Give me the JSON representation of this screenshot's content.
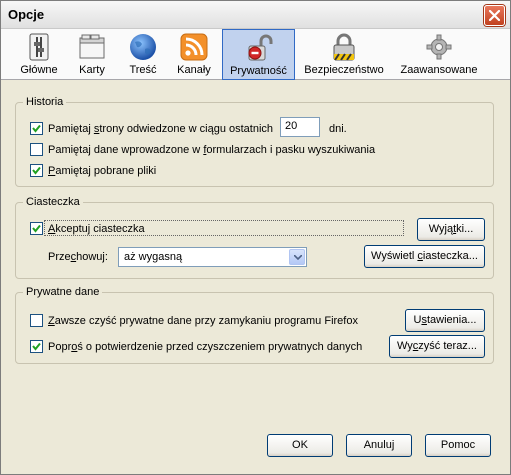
{
  "window": {
    "title": "Opcje"
  },
  "tabs": [
    {
      "label": "Główne",
      "icon": "general-switch-icon"
    },
    {
      "label": "Karty",
      "icon": "tabs-window-icon"
    },
    {
      "label": "Treść",
      "icon": "globe-icon"
    },
    {
      "label": "Kanały",
      "icon": "rss-feed-icon"
    },
    {
      "label": "Prywatność",
      "icon": "privacy-padlock-icon",
      "active": true
    },
    {
      "label": "Bezpieczeństwo",
      "icon": "security-padlock-icon"
    },
    {
      "label": "Zaawansowane",
      "icon": "gear-icon"
    }
  ],
  "historia": {
    "title": "Historia",
    "remember_pages": {
      "label_pre": "Pamiętaj ",
      "label_u": "s",
      "label_post": "trony odwiedzone w ciągu ostatnich",
      "checked": true
    },
    "days_value": "20",
    "days_unit": "dni.",
    "remember_forms": {
      "label_pre": "Pamiętaj dane wprowadzone w ",
      "label_u": "f",
      "label_post": "ormularzach i pasku wyszukiwania",
      "checked": false
    },
    "remember_downloads": {
      "label_pre": "",
      "label_u": "P",
      "label_post": "amiętaj pobrane pliki",
      "checked": true
    }
  },
  "ciasteczka": {
    "title": "Ciasteczka",
    "accept": {
      "label_pre": "",
      "label_u": "A",
      "label_post": "kceptuj ciasteczka",
      "checked": true
    },
    "exceptions_button": {
      "pre": "Wyją",
      "u": "t",
      "post": "ki..."
    },
    "keep_label": {
      "pre": "Prze",
      "u": "c",
      "post": "howuj:"
    },
    "keep_value": "aż wygasną",
    "show_button": {
      "pre": "Wyświetl ",
      "u": "c",
      "post": "iasteczka..."
    }
  },
  "prywatne": {
    "title": "Prywatne dane",
    "always_clear": {
      "label_pre": "",
      "label_u": "Z",
      "label_post": "awsze czyść prywatne dane przy zamykaniu programu Firefox",
      "checked": false
    },
    "settings_button": {
      "pre": "U",
      "u": "s",
      "post": "tawienia..."
    },
    "ask_before": {
      "label_pre": "Popr",
      "label_u": "o",
      "label_post": "ś o potwierdzenie przed czyszczeniem prywatnych danych",
      "checked": true
    },
    "clear_now_button": {
      "pre": "Wy",
      "u": "c",
      "post": "zyść teraz..."
    }
  },
  "footer": {
    "ok": "OK",
    "cancel": "Anuluj",
    "help": "Pomoc"
  }
}
